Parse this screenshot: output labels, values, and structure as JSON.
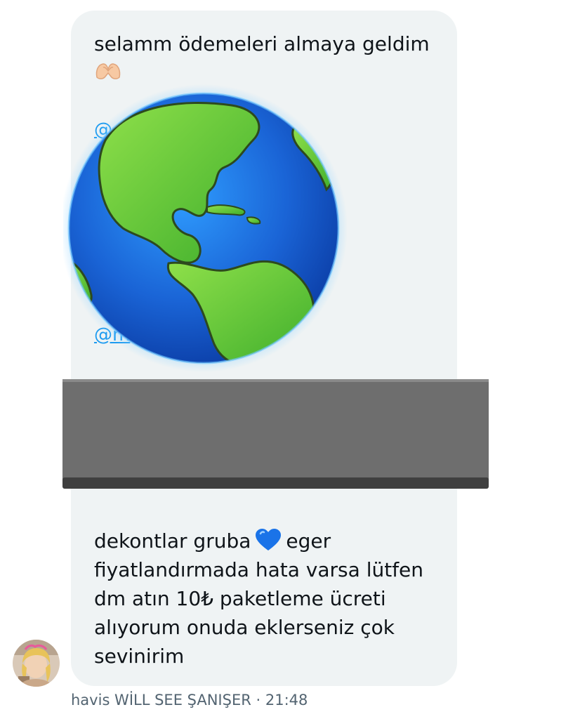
{
  "message": {
    "intro_text": "selamm ödemeleri almaya geldim",
    "intro_emoji": "heart-hands-icon",
    "mention_fragment_top": "@",
    "mention_fragment_bottom": "@m",
    "body_line_1_start": "dekontlar gruba",
    "body_line_1_emoji": "blue-heart-icon",
    "body_line_1_end": "eger",
    "body_rest": "fiyatlandırmada hata varsa lütfen\ndm atın 10₺ paketleme ücreti\nalıyorum onuda eklerseniz çok\nsevinirim"
  },
  "meta": {
    "sender": "havis WİLL SEE ŞANIŞER",
    "separator": " · ",
    "time": "21:48"
  },
  "colors": {
    "bubble_bg": "#eff3f4",
    "text": "#0f1419",
    "meta_text": "#536471",
    "link": "#1d9bf0",
    "redaction": "#6e6e6e"
  }
}
